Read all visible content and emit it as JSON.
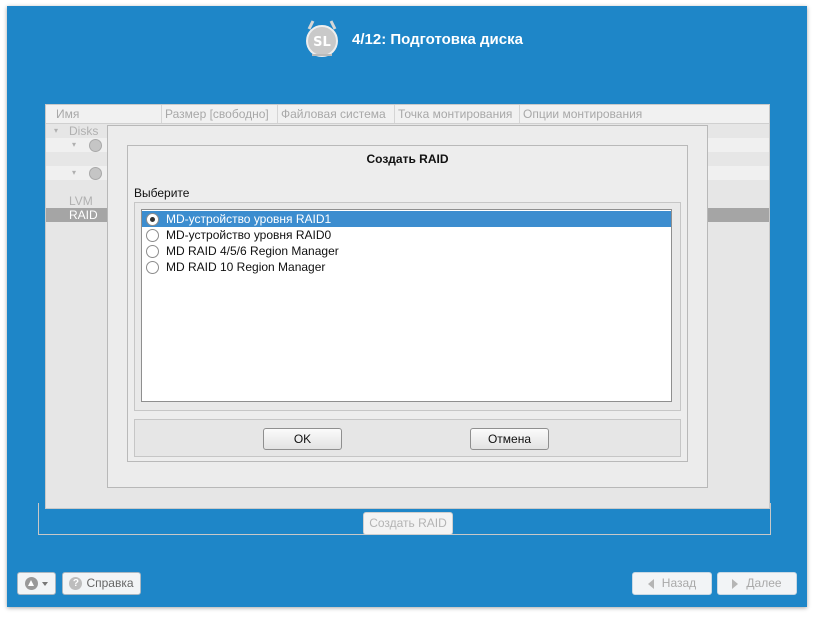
{
  "header": {
    "logo_text": "SL",
    "title": "4/12: Подготовка диска"
  },
  "background_table": {
    "columns": [
      "Имя",
      "Размер [свободно]",
      "Файловая система",
      "Точка монтирования",
      "Опции монтирования"
    ],
    "rows": {
      "disks": "Disks",
      "lvm": "LVM",
      "raid": "RAID"
    },
    "create_raid_button": "Создать RAID"
  },
  "dialog": {
    "title": "Создать RAID",
    "prompt": "Выберите",
    "options": [
      {
        "label": "MD-устройство уровня RAID1",
        "selected": true
      },
      {
        "label": "MD-устройство уровня RAID0",
        "selected": false
      },
      {
        "label": "MD RAID 4/5/6 Region Manager",
        "selected": false
      },
      {
        "label": "MD RAID 10 Region Manager",
        "selected": false
      }
    ],
    "ok_label": "OK",
    "cancel_label": "Отмена"
  },
  "footer": {
    "help_label": "Справка",
    "back_label": "Назад",
    "next_label": "Далее"
  },
  "colors": {
    "frame": "#1e86c8",
    "selection": "#3c8dcf"
  },
  "icons": [
    "scientific-linux-logo",
    "arrow-up-icon",
    "chevron-down-icon",
    "help-icon",
    "back-arrow-icon",
    "forward-arrow-icon",
    "disk-icon",
    "expander-icon"
  ]
}
